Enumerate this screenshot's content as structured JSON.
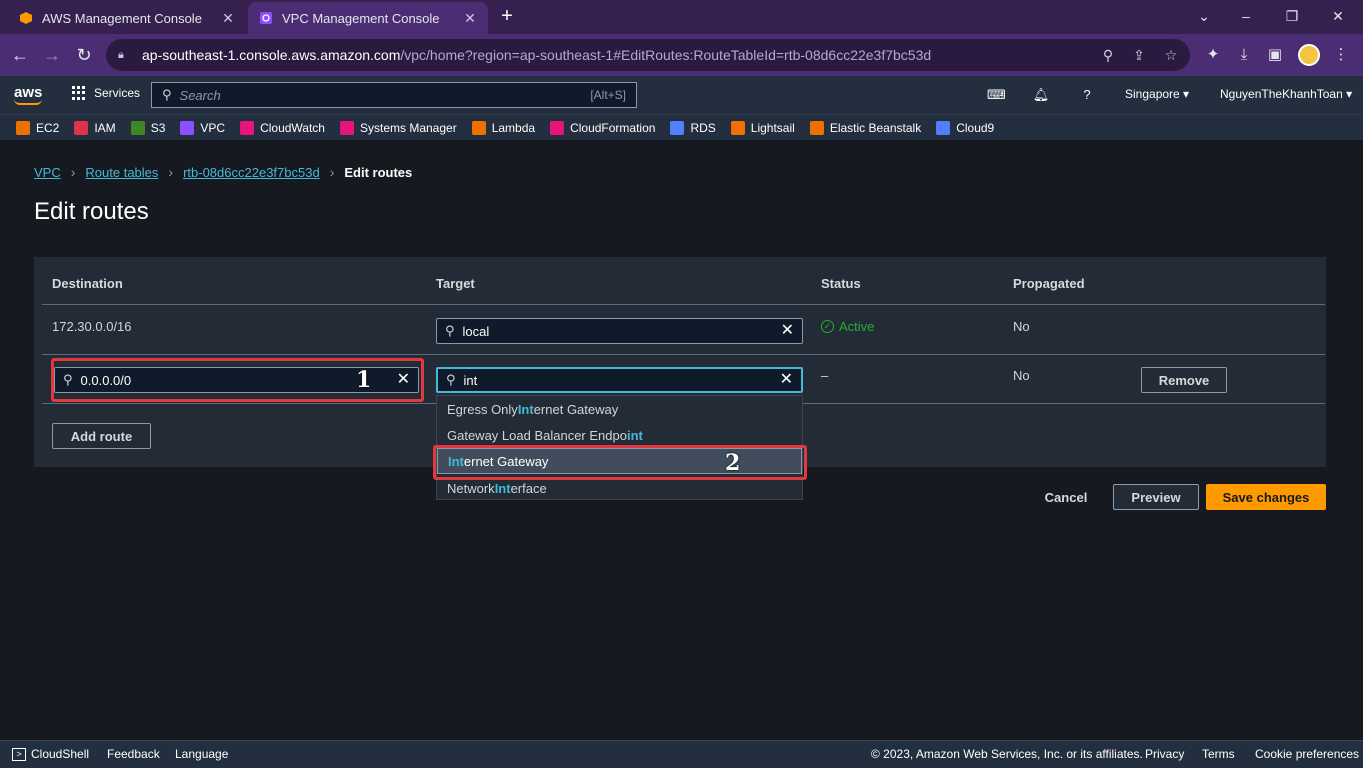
{
  "browser": {
    "tabs": [
      {
        "title": "AWS Management Console",
        "active": false,
        "favicon": "aws-cube-icon"
      },
      {
        "title": "VPC Management Console",
        "active": true,
        "favicon": "vpc-icon"
      }
    ],
    "url_host": "ap-southeast-1.console.aws.amazon.com",
    "url_path": "/vpc/home?region=ap-southeast-1#EditRoutes:RouteTableId=rtb-08d6cc22e3f7bc53d"
  },
  "aws_nav": {
    "logo": "aws",
    "services_label": "Services",
    "search_placeholder": "Search",
    "search_shortcut": "[Alt+S]",
    "region": "Singapore ▾",
    "account": "NguyenTheKhanhToan ▾"
  },
  "favorites": [
    {
      "label": "EC2",
      "color": "#ed7100"
    },
    {
      "label": "IAM",
      "color": "#dd344c"
    },
    {
      "label": "S3",
      "color": "#3f8624"
    },
    {
      "label": "VPC",
      "color": "#8c4fff"
    },
    {
      "label": "CloudWatch",
      "color": "#e7157b"
    },
    {
      "label": "Systems Manager",
      "color": "#e7157b"
    },
    {
      "label": "Lambda",
      "color": "#ed7100"
    },
    {
      "label": "CloudFormation",
      "color": "#e7157b"
    },
    {
      "label": "RDS",
      "color": "#527fff"
    },
    {
      "label": "Lightsail",
      "color": "#ed7100"
    },
    {
      "label": "Elastic Beanstalk",
      "color": "#ed7100"
    },
    {
      "label": "Cloud9",
      "color": "#527fff"
    }
  ],
  "breadcrumb": {
    "vpc": "VPC",
    "route_tables": "Route tables",
    "rtb": "rtb-08d6cc22e3f7bc53d",
    "current": "Edit routes"
  },
  "page_title": "Edit routes",
  "table": {
    "headers": {
      "destination": "Destination",
      "target": "Target",
      "status": "Status",
      "propagated": "Propagated"
    },
    "row1": {
      "destination": "172.30.0.0/16",
      "target": "local",
      "status": "Active",
      "propagated": "No"
    },
    "row2": {
      "destination": "0.0.0.0/0",
      "target": "int",
      "status": "–",
      "propagated": "No",
      "remove": "Remove"
    }
  },
  "dropdown": {
    "items": [
      {
        "pre": "Egress Only ",
        "hl": "Int",
        "post": "ernet Gateway"
      },
      {
        "pre": "Gateway Load Balancer Endpo",
        "hl": "int",
        "post": ""
      },
      {
        "pre": "",
        "hl": "Int",
        "post": "ernet Gateway"
      },
      {
        "pre": "Network ",
        "hl": "Int",
        "post": "erface"
      }
    ],
    "selected_index": 2
  },
  "buttons": {
    "add_route": "Add route",
    "cancel": "Cancel",
    "preview": "Preview",
    "save": "Save changes"
  },
  "annotations": {
    "one": "1",
    "two": "2"
  },
  "footer": {
    "cloudshell": "CloudShell",
    "feedback": "Feedback",
    "language": "Language",
    "copyright": "© 2023, Amazon Web Services, Inc. or its affiliates.",
    "privacy": "Privacy",
    "terms": "Terms",
    "cookies": "Cookie preferences"
  }
}
